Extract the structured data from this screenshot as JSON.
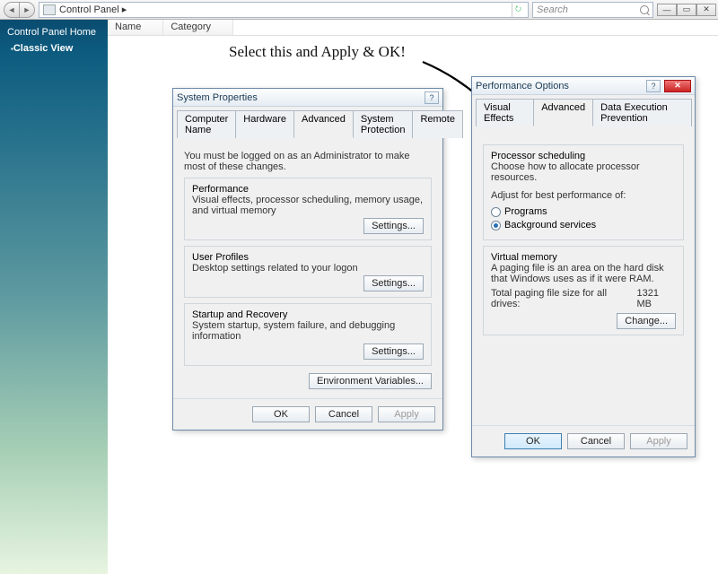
{
  "addressbar": {
    "breadcrumb": "Control Panel  ▸",
    "search_placeholder": "Search"
  },
  "columns": {
    "name": "Name",
    "category": "Category"
  },
  "sidebar": {
    "home": "Control Panel Home",
    "classic": "Classic View"
  },
  "headline": "Select this and Apply & OK!",
  "sysprops": {
    "title": "System Properties",
    "tabs": [
      "Computer Name",
      "Hardware",
      "Advanced",
      "System Protection",
      "Remote"
    ],
    "admin_note": "You must be logged on as an Administrator to make most of these changes.",
    "perf": {
      "legend": "Performance",
      "desc": "Visual effects, processor scheduling, memory usage, and virtual memory",
      "btn": "Settings..."
    },
    "profiles": {
      "legend": "User Profiles",
      "desc": "Desktop settings related to your logon",
      "btn": "Settings..."
    },
    "startup": {
      "legend": "Startup and Recovery",
      "desc": "System startup, system failure, and debugging information",
      "btn": "Settings..."
    },
    "envbtn": "Environment Variables...",
    "ok": "OK",
    "cancel": "Cancel",
    "apply": "Apply"
  },
  "perfopts": {
    "title": "Performance Options",
    "tabs": [
      "Visual Effects",
      "Advanced",
      "Data Execution Prevention"
    ],
    "sched": {
      "legend": "Processor scheduling",
      "line1": "Choose how to allocate processor resources.",
      "line2": "Adjust for best performance of:",
      "opt1": "Programs",
      "opt2": "Background services"
    },
    "vmem": {
      "legend": "Virtual memory",
      "line1": "A paging file is an area on the hard disk that Windows uses as if it were RAM.",
      "line2a": "Total paging file size for all drives:",
      "line2b": "1321 MB",
      "btn": "Change..."
    },
    "ok": "OK",
    "cancel": "Cancel",
    "apply": "Apply"
  }
}
